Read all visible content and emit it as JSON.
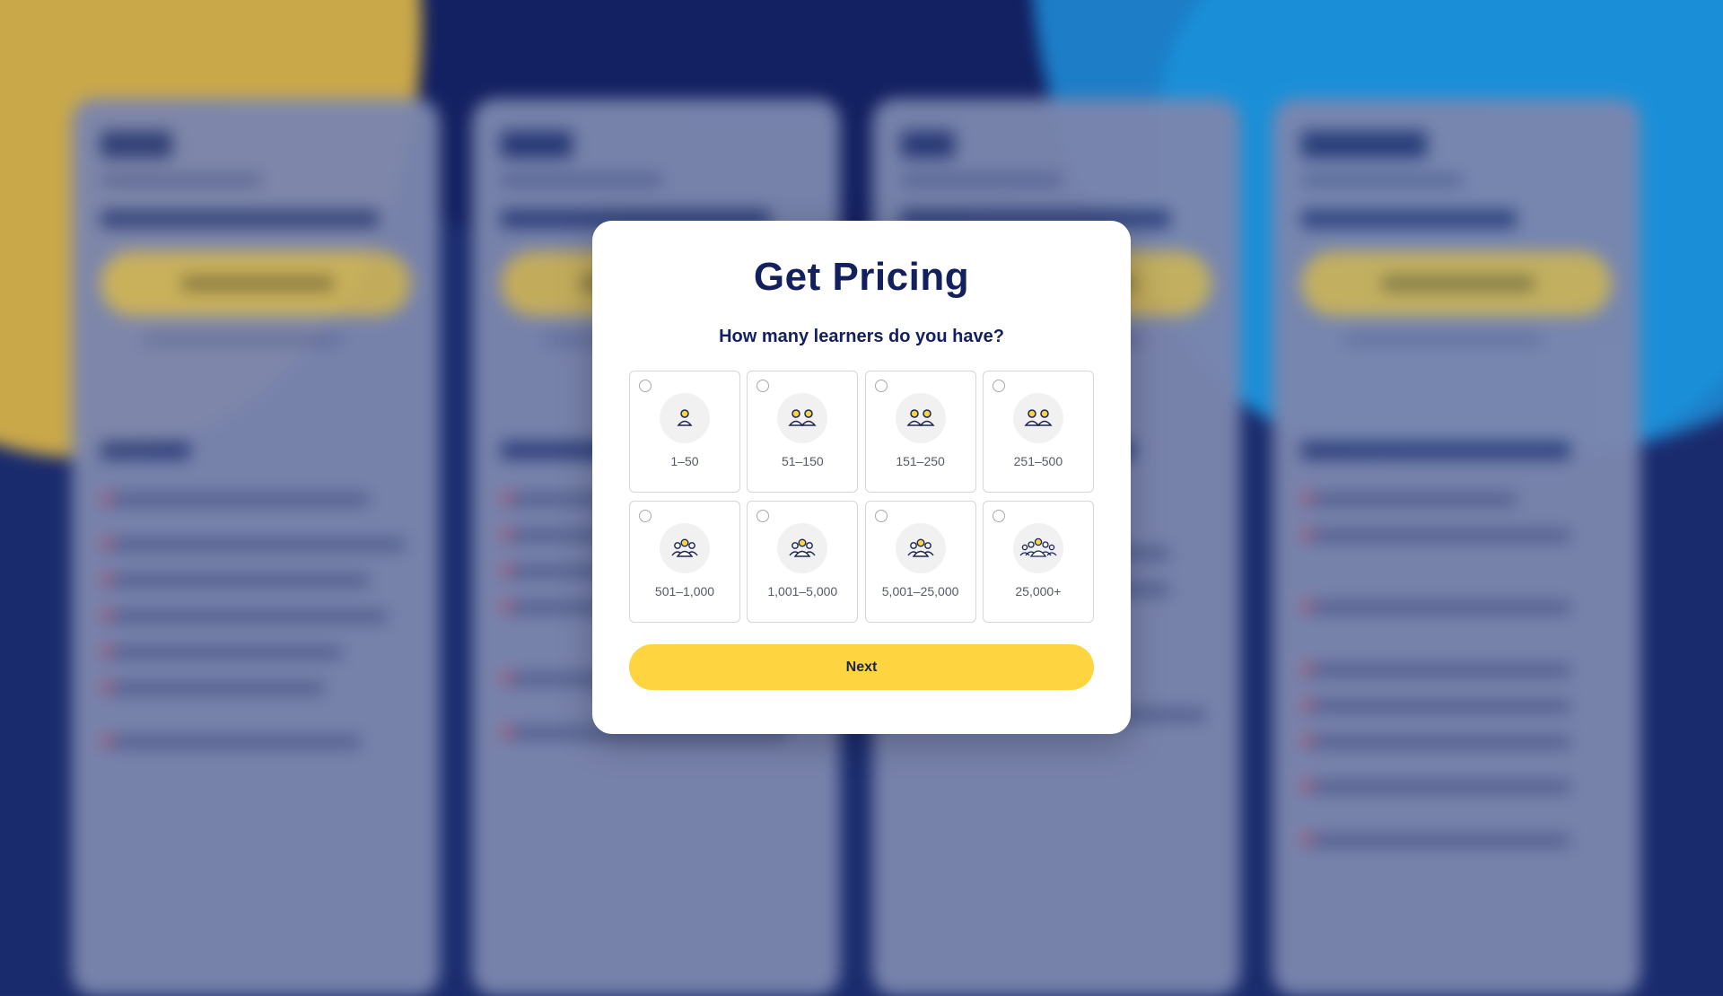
{
  "modal": {
    "title": "Get Pricing",
    "question": "How many learners do you have?",
    "options": [
      {
        "label": "1–50",
        "icon": "single-person-icon"
      },
      {
        "label": "51–150",
        "icon": "two-people-icon"
      },
      {
        "label": "151–250",
        "icon": "two-people-icon"
      },
      {
        "label": "251–500",
        "icon": "two-people-icon"
      },
      {
        "label": "501–1,000",
        "icon": "small-group-icon"
      },
      {
        "label": "1,001–5,000",
        "icon": "small-group-icon"
      },
      {
        "label": "5,001–25,000",
        "icon": "small-group-icon"
      },
      {
        "label": "25,000+",
        "icon": "large-group-icon"
      }
    ],
    "next_label": "Next"
  },
  "colors": {
    "accent": "#FED440",
    "heading": "#13205E",
    "backdrop": "#1B2C6E"
  }
}
